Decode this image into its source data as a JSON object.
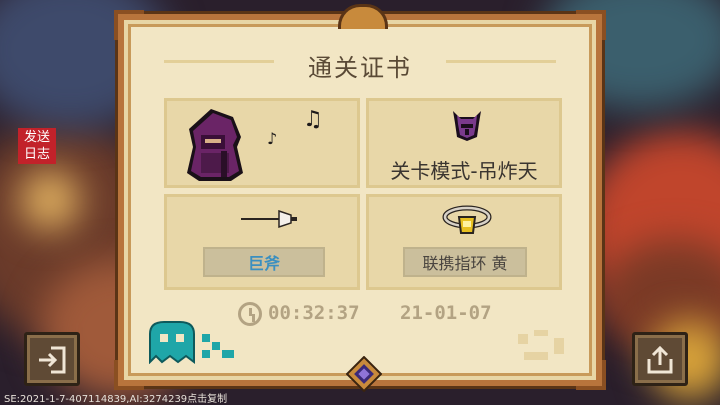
{
  "certificate": {
    "title": "通关证书",
    "mode_label": "关卡模式-吊炸天",
    "weapon_label": "巨斧",
    "ring_label": "联携指环 黄",
    "time": "00:32:37",
    "date": "21-01-07"
  },
  "side_badge": {
    "line1": "发送",
    "line2": "日志"
  },
  "footer": {
    "text": "SE:2021-1-7-407114839,AI:3274239点击复制"
  },
  "colors": {
    "paper": "#f2e6c4",
    "frame": "#b8743c",
    "weapon_tag_text": "#3a8fc0",
    "badge": "#c2222a"
  },
  "icons": {
    "exit": "exit-door-icon",
    "share": "share-icon",
    "clock": "clock-icon",
    "helmet": "demon-helmet-icon"
  }
}
